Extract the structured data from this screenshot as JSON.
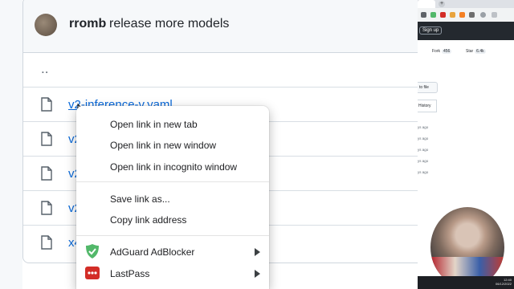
{
  "commit": {
    "author": "rromb",
    "message": "release more models"
  },
  "files": {
    "parent": "..",
    "names": [
      "v2-inference-v.yaml",
      "v2",
      "v2",
      "v2",
      "x4"
    ]
  },
  "context_menu": {
    "items": [
      {
        "label": "Open link in new tab"
      },
      {
        "label": "Open link in new window"
      },
      {
        "label": "Open link in incognito window"
      },
      {
        "label": "Save link as..."
      },
      {
        "label": "Copy link address"
      }
    ],
    "extensions": [
      {
        "label": "AdGuard AdBlocker",
        "icon": "adguard-shield-icon",
        "color": "#52b86a"
      },
      {
        "label": "LastPass",
        "icon": "lastpass-icon",
        "color": "#d32d27"
      }
    ]
  },
  "right_panel": {
    "sign_up": "Sign up",
    "fork_label": "Fork",
    "fork_count": "456",
    "star_label": "Star",
    "star_count": "6.4k",
    "to_file": "to file",
    "history": "History",
    "ago": [
      "ys ago",
      "ys ago",
      "ys ago",
      "ys ago",
      "ys ago"
    ],
    "clock_time": "12:40",
    "clock_date": "06/12/2022"
  }
}
